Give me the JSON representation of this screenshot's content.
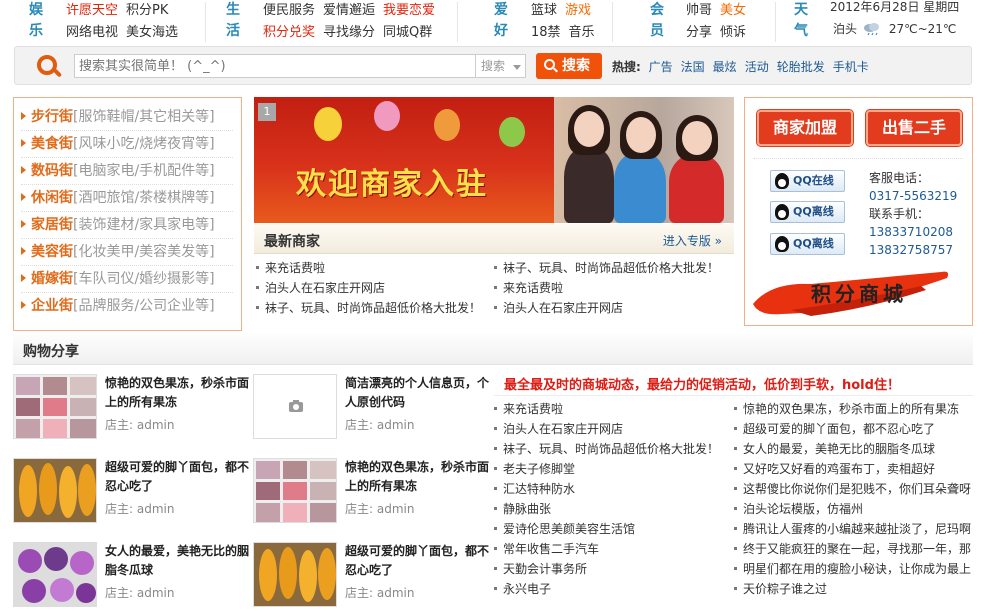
{
  "nav": {
    "groups": [
      {
        "cat": [
          "娱",
          "乐"
        ],
        "rows": [
          [
            "许愿天空",
            "积分PK"
          ],
          [
            "网络电视",
            "美女海选"
          ]
        ]
      },
      {
        "cat": [
          "生",
          "活"
        ],
        "rows": [
          [
            "便民服务",
            "爱情邂逅",
            "我要恋爱"
          ],
          [
            "积分兑奖",
            "寻找缘分",
            "同城Q群"
          ]
        ]
      },
      {
        "cat": [
          "爱",
          "好"
        ],
        "rows": [
          [
            "篮球",
            "游戏"
          ],
          [
            "18禁",
            "音乐"
          ]
        ]
      },
      {
        "cat": [
          "会",
          "员"
        ],
        "rows": [
          [
            "帅哥",
            "美女"
          ],
          [
            "分享",
            "倾诉"
          ]
        ]
      },
      {
        "cat": [
          "天",
          "气"
        ]
      }
    ],
    "date": "2012年6月28日 星期四",
    "city": "泊头",
    "temp": "27℃~21℃"
  },
  "search": {
    "placeholder": "搜索其实很简单！ (^_^)",
    "select": "搜索",
    "button": "搜索",
    "hot_label": "热搜:",
    "hot": [
      "广告",
      "法国",
      "最炫",
      "活动",
      "轮胎批发",
      "手机卡"
    ]
  },
  "streets": [
    {
      "name": "步行街",
      "sub": "[服饰鞋帽/其它相关等]"
    },
    {
      "name": "美食街",
      "sub": "[风味小吃/烧烤夜宵等]"
    },
    {
      "name": "数码街",
      "sub": "[电脑家电/手机配件等]"
    },
    {
      "name": "休闲街",
      "sub": "[酒吧旅馆/茶楼棋牌等]"
    },
    {
      "name": "家居街",
      "sub": "[装饰建材/家具家电等]"
    },
    {
      "name": "美容街",
      "sub": "[化妆美甲/美容美发等]"
    },
    {
      "name": "婚嫁街",
      "sub": "[车队司仪/婚纱摄影等]"
    },
    {
      "name": "企业街",
      "sub": "[品牌服务/公司企业等]"
    }
  ],
  "banner": {
    "index": "1",
    "text": "欢迎商家入驻"
  },
  "newest": {
    "title": "最新商家",
    "more": "进入专版 »",
    "left": [
      "来充话费啦",
      "泊头人在石家庄开网店",
      "袜子、玩具、时尚饰品超低价格大批发！"
    ],
    "right": [
      "袜子、玩具、时尚饰品超低价格大批发！",
      "来充话费啦",
      "泊头人在石家庄开网店"
    ]
  },
  "panel": {
    "join": "商家加盟",
    "sell": "出售二手",
    "qq": [
      "QQ在线",
      "QQ离线",
      "QQ离线"
    ],
    "service_label": "客服电话：",
    "service_phone": "0317-5563219",
    "mobile_label": "联系手机：",
    "mobiles": [
      "13833710208",
      "13832758757"
    ],
    "mall": "积分商城"
  },
  "share": {
    "title": "购物分享",
    "owner_prefix": "店主: ",
    "cards": [
      {
        "title": "惊艳的双色果冻，秒杀市面上的所有果冻",
        "owner": "店主: admin"
      },
      {
        "title": "简洁漂亮的个人信息页，个人原创代码",
        "owner": "店主: admin"
      },
      {
        "title": "超级可爱的脚丫面包，都不忍心吃了",
        "owner": "店主: admin"
      },
      {
        "title": "惊艳的双色果冻，秒杀市面上的所有果冻",
        "owner": "店主: admin"
      },
      {
        "title": "女人的最爱，美艳无比的胭脂冬瓜球",
        "owner": "店主: admin"
      },
      {
        "title": "超级可爱的脚丫面包，都不忍心吃了",
        "owner": "店主: admin"
      }
    ]
  },
  "promo": {
    "title": "最全最及时的商城动态，最给力的促销活动，低价到手软，hold住！",
    "left": [
      "来充话费啦",
      "泊头人在石家庄开网店",
      "袜子、玩具、时尚饰品超低价格大批发！",
      "老夫子修脚堂",
      "汇达特种防水",
      "静脉曲张",
      "爱诗伦思美颜美容生活馆",
      "常年收售二手汽车",
      "天勤会计事务所",
      "永兴电子"
    ],
    "right": [
      "惊艳的双色果冻，秒杀市面上的所有果冻",
      "超级可爱的脚丫面包，都不忍心吃了",
      "女人的最爱，美艳无比的胭脂冬瓜球",
      "又好吃又好看的鸡蛋布丁，卖相超好",
      "这帮傻比你说你们是犯贱不，你们耳朵聋呀",
      "泊头论坛模版，仿福州",
      "腾讯让人蛋疼的小编越来越扯淡了，尼玛啊",
      "终于又能疯狂的聚在一起，寻找那一年，那",
      "明星们都在用的瘦脸小秘诀，让你成为最上",
      "天价粽子谁之过"
    ]
  },
  "colors": {
    "accent": "#f0520a",
    "street": "#e06b1a",
    "link": "#1d5a93",
    "promo": "#dd1c14",
    "nav": "#2a89b8"
  }
}
